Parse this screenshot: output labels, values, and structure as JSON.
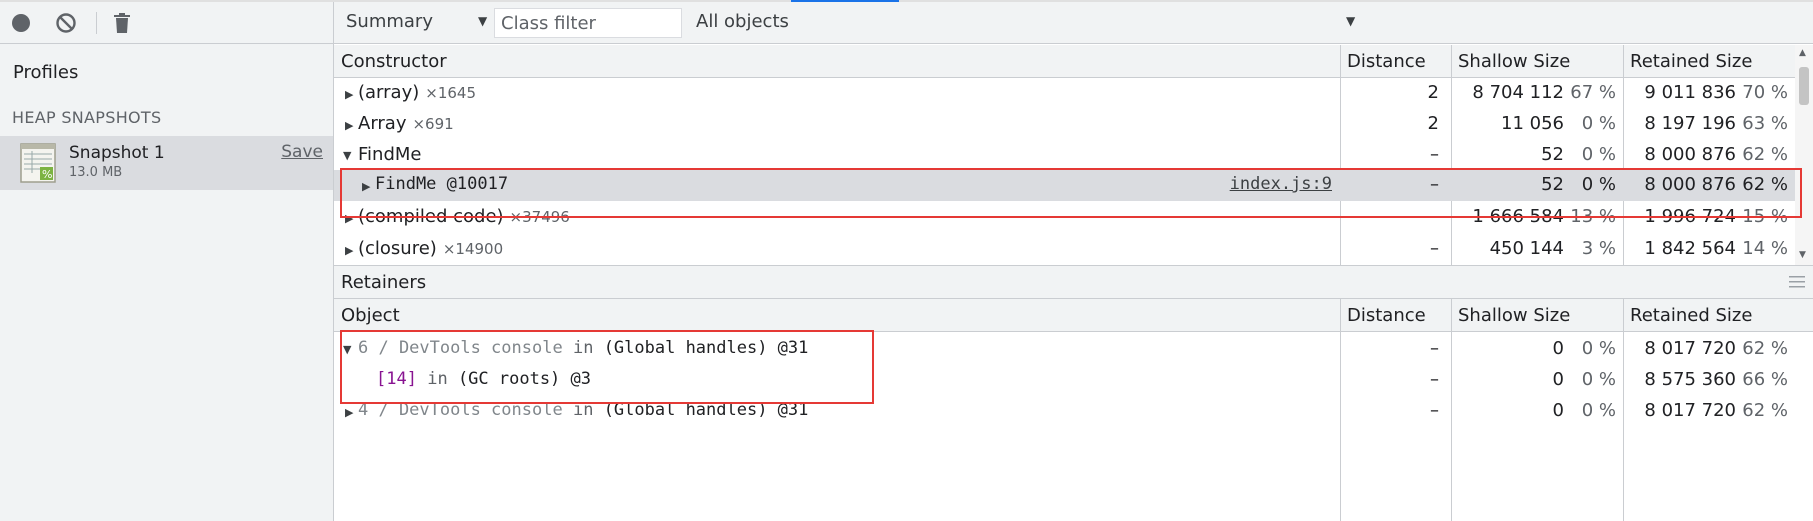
{
  "toolbar": {
    "record_label": "Take heap snapshot",
    "clear_label": "Clear all profiles",
    "gc_label": "Collect garbage"
  },
  "sidebar": {
    "title": "Profiles",
    "section_title": "HEAP SNAPSHOTS",
    "snapshot": {
      "name": "Snapshot 1",
      "size": "13.0 MB",
      "save_label": "Save"
    }
  },
  "main_toolbar": {
    "view": "Summary",
    "class_filter": {
      "value": "",
      "placeholder": "Class filter"
    },
    "objects": "All objects"
  },
  "constructors": {
    "headers": {
      "constructor": "Constructor",
      "distance": "Distance",
      "shallow": "Shallow Size",
      "retained": "Retained Size"
    },
    "rows": [
      {
        "name": "(array)",
        "count": "×1645",
        "distance": "2",
        "shallow": "8 704 112",
        "shallow_pct": "67 %",
        "retained": "9 011 836",
        "retained_pct": "70 %"
      },
      {
        "name": "Array",
        "count": "×691",
        "distance": "2",
        "shallow": "11 056",
        "shallow_pct": "0 %",
        "retained": "8 197 196",
        "retained_pct": "63 %"
      },
      {
        "name": "FindMe",
        "count": "",
        "distance": "–",
        "shallow": "52",
        "shallow_pct": "0 %",
        "retained": "8 000 876",
        "retained_pct": "62 %"
      },
      {
        "name": "FindMe @10017",
        "link": "index.js:9",
        "distance": "–",
        "shallow": "52",
        "shallow_pct": "0 %",
        "retained": "8 000 876",
        "retained_pct": "62 %"
      },
      {
        "name": "(compiled code)",
        "count": "×37496",
        "distance": "–",
        "shallow": "1 666 584",
        "shallow_pct": "13 %",
        "retained": "1 996 724",
        "retained_pct": "15 %"
      },
      {
        "name": "(closure)",
        "count": "×14900",
        "distance": "–",
        "shallow": "450 144",
        "shallow_pct": "3 %",
        "retained": "1 842 564",
        "retained_pct": "14 %"
      }
    ]
  },
  "retainers": {
    "title": "Retainers",
    "headers": {
      "object": "Object",
      "distance": "Distance",
      "shallow": "Shallow Size",
      "retained": "Retained Size"
    },
    "rows": [
      {
        "prefix": "6 / DevTools console",
        "kw": "in",
        "target": "(Global handles) @31",
        "distance": "–",
        "shallow": "0",
        "shallow_pct": "0 %",
        "retained": "8 017 720",
        "retained_pct": "62 %"
      },
      {
        "prefix": "[14]",
        "kw": "in",
        "target": "(GC roots) @3",
        "distance": "–",
        "shallow": "0",
        "shallow_pct": "0 %",
        "retained": "8 575 360",
        "retained_pct": "66 %"
      },
      {
        "prefix": "4 / DevTools console",
        "kw": "in",
        "target": "(Global handles) @31",
        "distance": "–",
        "shallow": "0",
        "shallow_pct": "0 %",
        "retained": "8 017 720",
        "retained_pct": "62 %"
      }
    ]
  },
  "colors": {
    "accent": "#1a73e8",
    "highlight": "#e53935",
    "index_purple": "#881391",
    "grey_text": "#80868b"
  }
}
